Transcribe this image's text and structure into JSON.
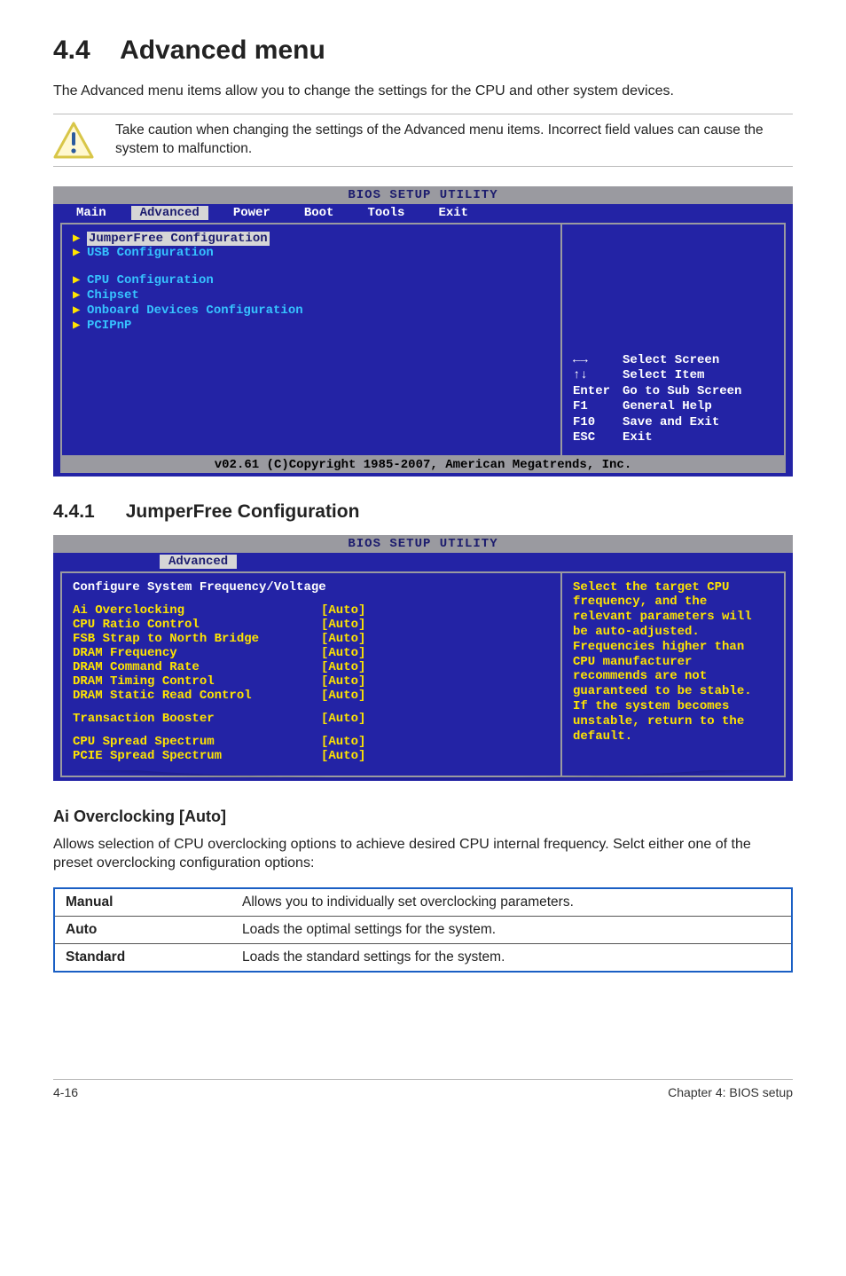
{
  "section": {
    "number": "4.4",
    "title": "Advanced menu",
    "intro": "The Advanced menu items allow you to change the settings for the CPU and other system devices.",
    "caution": "Take caution when changing the settings of the Advanced menu items. Incorrect field values can cause the system to malfunction."
  },
  "bios1": {
    "title": "BIOS SETUP UTILITY",
    "tabs": [
      "Main",
      "Advanced",
      "Power",
      "Boot",
      "Tools",
      "Exit"
    ],
    "selected_tab": "Advanced",
    "items_group1": [
      "JumperFree Configuration",
      "USB Configuration"
    ],
    "items_group2": [
      "CPU Configuration",
      "Chipset",
      "Onboard Devices Configuration",
      "PCIPnP"
    ],
    "help_keys": [
      {
        "k": "←→",
        "d": "Select Screen"
      },
      {
        "k": "↑↓",
        "d": "Select Item"
      },
      {
        "k": "Enter",
        "d": "Go to Sub Screen"
      },
      {
        "k": "F1",
        "d": "General Help"
      },
      {
        "k": "F10",
        "d": "Save and Exit"
      },
      {
        "k": "ESC",
        "d": "Exit"
      }
    ],
    "footer": "v02.61 (C)Copyright 1985-2007, American Megatrends, Inc."
  },
  "subsection": {
    "number": "4.4.1",
    "title": "JumperFree Configuration"
  },
  "bios2": {
    "title": "BIOS SETUP UTILITY",
    "tab": "Advanced",
    "header": "Configure System Frequency/Voltage",
    "rows": [
      {
        "label": "Ai Overclocking",
        "val": "[Auto]"
      },
      {
        "label": "CPU Ratio Control",
        "val": "[Auto]"
      },
      {
        "label": "FSB Strap to North Bridge",
        "val": "[Auto]"
      },
      {
        "label": "DRAM Frequency",
        "val": "[Auto]"
      },
      {
        "label": "DRAM Command Rate",
        "val": "[Auto]"
      },
      {
        "label": "DRAM Timing Control",
        "val": "[Auto]"
      },
      {
        "label": "DRAM Static Read Control",
        "val": "[Auto]"
      }
    ],
    "rows2": [
      {
        "label": "Transaction Booster",
        "val": "[Auto]"
      }
    ],
    "rows3": [
      {
        "label": "CPU Spread Spectrum",
        "val": "[Auto]"
      },
      {
        "label": "PCIE Spread Spectrum",
        "val": "[Auto]"
      }
    ],
    "help_text": "Select the target CPU frequency, and the relevant parameters will be auto-adjusted. Frequencies higher than CPU manufacturer recommends are not guaranteed to be stable. If the system becomes unstable, return to the default."
  },
  "ai_head": "Ai Overclocking [Auto]",
  "ai_body": "Allows selection of CPU overclocking options to achieve desired CPU internal frequency. Selct either one of the preset overclocking configuration options:",
  "opts": [
    {
      "k": "Manual",
      "d": "Allows you to individually set overclocking parameters."
    },
    {
      "k": "Auto",
      "d": "Loads the optimal settings for the system."
    },
    {
      "k": "Standard",
      "d": "Loads the standard settings for the system."
    }
  ],
  "footer": {
    "left": "4-16",
    "right": "Chapter 4: BIOS setup"
  }
}
